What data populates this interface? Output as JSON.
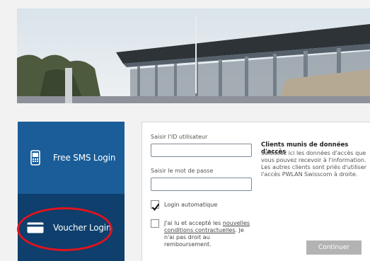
{
  "tabs": {
    "sms_label": "Free SMS Login",
    "voucher_label": "Voucher Login"
  },
  "form": {
    "user_id_label": "Saisir l'ID utilisateur",
    "user_id_value": "",
    "password_label": "Saisir le mot de passe",
    "password_value": "",
    "auto_login_label": "Login automatique",
    "auto_login_checked": true,
    "terms_prefix": "J'ai lu et accepté les",
    "terms_link": "nouvelles conditions contractuelles",
    "terms_suffix": ". Je n'ai pas droit au remboursement.",
    "terms_checked": false,
    "continue_label": "Continuer"
  },
  "info": {
    "title": "Clients munis de données d'accès",
    "body": "Saisissez ici les données d'accès que vous pouvez recevoir à l'information. Les autres clients sont priés d'utiliser l'accès PWLAN Swisscom à droite."
  },
  "colors": {
    "tab_sms": "#1a5d99",
    "tab_voucher": "#0e3f6d",
    "highlight_ring": "#e0141e",
    "button_disabled": "#b3b3b3"
  }
}
